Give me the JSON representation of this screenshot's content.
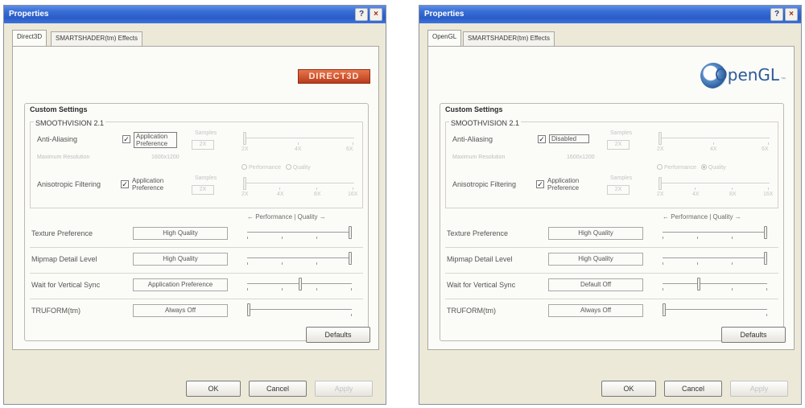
{
  "windows": [
    {
      "title": "Properties",
      "help_label": "?",
      "close_label": "×",
      "tabs": [
        "Direct3D",
        "SMARTSHADER(tm) Effects"
      ],
      "logo": "DIRECT3D",
      "custom_title": "Custom Settings",
      "smooth_title": "SMOOTHVISION 2.1",
      "anti_aliasing": {
        "label": "Anti-Aliasing",
        "checked": true,
        "option": "Application Preference"
      },
      "max_res": {
        "label": "Maximum Resolution",
        "value": "1600x1200"
      },
      "samples_label": "Samples",
      "aa_samples": "2X",
      "aa_scale": [
        "2X",
        "4X",
        "6X"
      ],
      "radio_perf": "Performance",
      "radio_quality": "Quality",
      "aniso": {
        "label": "Anisotropic Filtering",
        "checked": true,
        "option": "Application Preference",
        "samples": "2X",
        "scale": [
          "2X",
          "4X",
          "8X",
          "16X"
        ]
      },
      "perf_quality": "← Performance | Quality →",
      "texture": {
        "label": "Texture Preference",
        "value": "High Quality"
      },
      "mipmap": {
        "label": "Mipmap Detail Level",
        "value": "High Quality"
      },
      "vsync": {
        "label": "Wait for Vertical Sync",
        "value": "Application Preference"
      },
      "truform": {
        "label": "TRUFORM(tm)",
        "value": "Always Off"
      },
      "defaults": "Defaults",
      "ok": "OK",
      "cancel": "Cancel",
      "apply": "Apply"
    },
    {
      "title": "Properties",
      "help_label": "?",
      "close_label": "×",
      "tabs": [
        "OpenGL",
        "SMARTSHADER(tm) Effects"
      ],
      "logo": "OpenGL",
      "logo_tm": "™",
      "custom_title": "Custom Settings",
      "smooth_title": "SMOOTHVISION 2.1",
      "anti_aliasing": {
        "label": "Anti-Aliasing",
        "checked": true,
        "option": "Disabled"
      },
      "max_res": {
        "label": "Maximum Resolution",
        "value": "1600x1200"
      },
      "samples_label": "Samples",
      "aa_samples": "2X",
      "aa_scale": [
        "2X",
        "4X",
        "6X"
      ],
      "radio_perf": "Performance",
      "radio_quality": "Quality",
      "aniso": {
        "label": "Anisotropic Filtering",
        "checked": true,
        "option": "Application Preference",
        "samples": "2X",
        "scale": [
          "2X",
          "4X",
          "8X",
          "16X"
        ]
      },
      "perf_quality": "← Performance | Quality →",
      "texture": {
        "label": "Texture Preference",
        "value": "High Quality"
      },
      "mipmap": {
        "label": "Mipmap Detail Level",
        "value": "High Quality"
      },
      "vsync": {
        "label": "Wait for Vertical Sync",
        "value": "Default Off"
      },
      "truform": {
        "label": "TRUFORM(tm)",
        "value": "Always Off"
      },
      "defaults": "Defaults",
      "ok": "OK",
      "cancel": "Cancel",
      "apply": "Apply"
    }
  ],
  "colors": {
    "title_bar": "#2a5cc7",
    "dialog_bg": "#ece9d8",
    "direct3d_logo": "#c9502c",
    "opengl_logo": "#2b5a98"
  }
}
